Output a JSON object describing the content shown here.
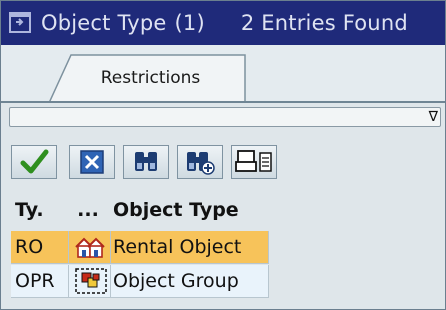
{
  "window": {
    "title": "Object Type",
    "count": "(1)",
    "entries": "2 Entries Found",
    "title_icon": "dialog-window-icon"
  },
  "tabs": [
    {
      "label": "Restrictions"
    }
  ],
  "filter": {
    "arrow": "∇"
  },
  "toolbar": {
    "buttons": [
      {
        "name": "continue",
        "icon": "checkmark-icon"
      },
      {
        "name": "cancel",
        "icon": "cancel-x-icon"
      },
      {
        "name": "find",
        "icon": "binoculars-icon"
      },
      {
        "name": "find-next",
        "icon": "binoculars-plus-icon"
      },
      {
        "name": "print",
        "icon": "printer-icon"
      },
      {
        "name": "details",
        "icon": "document-icon"
      }
    ]
  },
  "table": {
    "columns": [
      "Ty.",
      "...",
      "Object Type"
    ],
    "rows": [
      {
        "ty": "RO",
        "icon": "rental-object-icon",
        "object_type": "Rental Object",
        "selected": true
      },
      {
        "ty": "OPR",
        "icon": "object-group-icon",
        "object_type": "Object Group",
        "selected": false
      }
    ]
  },
  "colors": {
    "title_bar": "#1f2a7a",
    "selected_row": "#f7c35a",
    "row_background": "#e9f3fb"
  }
}
